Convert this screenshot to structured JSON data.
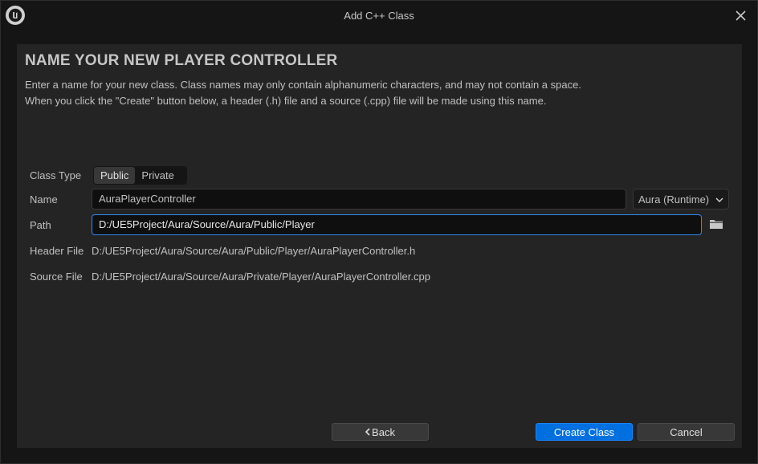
{
  "window": {
    "title": "Add C++ Class"
  },
  "heading": "NAME YOUR NEW PLAYER CONTROLLER",
  "description": {
    "line1": "Enter a name for your new class. Class names may only contain alphanumeric characters, and may not contain a space.",
    "line2": "When you click the \"Create\" button below, a header (.h) file and a source (.cpp) file will be made using this name."
  },
  "form": {
    "class_type": {
      "label": "Class Type",
      "options": [
        "Public",
        "Private"
      ],
      "selected": "Public"
    },
    "name": {
      "label": "Name",
      "value": "AuraPlayerController"
    },
    "module": {
      "value": "Aura (Runtime)"
    },
    "path": {
      "label": "Path",
      "value": "D:/UE5Project/Aura/Source/Aura/Public/Player"
    },
    "header_file": {
      "label": "Header File",
      "value": "D:/UE5Project/Aura/Source/Aura/Public/Player/AuraPlayerController.h"
    },
    "source_file": {
      "label": "Source File",
      "value": "D:/UE5Project/Aura/Source/Aura/Private/Player/AuraPlayerController.cpp"
    }
  },
  "buttons": {
    "back": "Back",
    "create": "Create Class",
    "cancel": "Cancel"
  },
  "icons": {
    "logo": "unreal-engine-logo-icon",
    "close": "close-icon",
    "chevron": "chevron-down-icon",
    "folder": "folder-icon",
    "back_chevron": "chevron-left-icon"
  },
  "colors": {
    "accent": "#0070e0",
    "focus_border": "#2f8af5",
    "panel_bg": "#242424",
    "window_bg": "#151515"
  }
}
